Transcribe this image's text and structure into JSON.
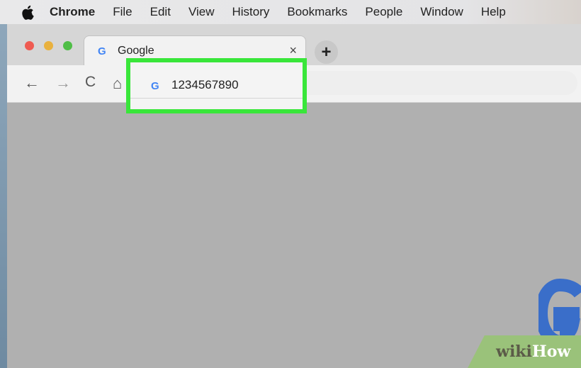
{
  "menubar": {
    "items": [
      "Chrome",
      "File",
      "Edit",
      "View",
      "History",
      "Bookmarks",
      "People",
      "Window",
      "Help"
    ]
  },
  "tab": {
    "favicon": "G",
    "title": "Google",
    "close": "×"
  },
  "new_tab": "+",
  "toolbar": {
    "back_icon": "←",
    "forward_icon": "→",
    "reload_icon": "C",
    "home_icon": "⌂"
  },
  "omnibox": {
    "favicon": "G",
    "value": "1234567890"
  },
  "watermark": {
    "wiki": "wiki",
    "how": "How"
  },
  "colors": {
    "highlight": "#39e63a",
    "google_blue": "#4285f4",
    "google_red": "#ea4335",
    "google_yellow": "#fbbc05",
    "google_green": "#34a853"
  }
}
